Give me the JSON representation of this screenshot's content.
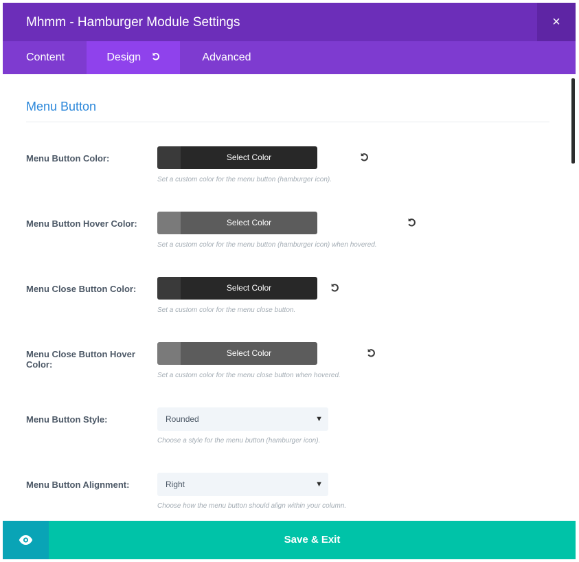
{
  "header": {
    "title": "Mhmm - Hamburger Module Settings",
    "close_glyph": "×"
  },
  "tabs": [
    {
      "label": "Content",
      "active": false
    },
    {
      "label": "Design",
      "active": true,
      "icon": "reset-icon"
    },
    {
      "label": "Advanced",
      "active": false
    }
  ],
  "section": {
    "title": "Menu Button"
  },
  "settings": {
    "menu_button_color": {
      "label": "Menu Button Color:",
      "button_label": "Select Color",
      "description": "Set a custom color for the menu button (hamburger icon).",
      "swatch_color": "#3a3a3a"
    },
    "menu_button_hover_color": {
      "label": "Menu Button Hover Color:",
      "button_label": "Select Color",
      "description": "Set a custom color for the menu button (hamburger icon) when hovered.",
      "swatch_color": "#7a7a7a"
    },
    "menu_close_button_color": {
      "label": "Menu Close Button Color:",
      "button_label": "Select Color",
      "description": "Set a custom color for the menu close button.",
      "swatch_color": "#3a3a3a"
    },
    "menu_close_button_hover_color": {
      "label": "Menu Close Button Hover Color:",
      "button_label": "Select Color",
      "description": "Set a custom color for the menu close button when hovered.",
      "swatch_color": "#7a7a7a"
    },
    "menu_button_style": {
      "label": "Menu Button Style:",
      "value": "Rounded",
      "description": "Choose a style for the menu button (hamburger icon)."
    },
    "menu_button_alignment": {
      "label": "Menu Button Alignment:",
      "value": "Right",
      "description": "Choose how the menu button should align within your column."
    }
  },
  "footer": {
    "preview_icon": "eye-icon",
    "save_label": "Save & Exit"
  },
  "colors": {
    "header_bg": "#6c2eb9",
    "tabs_bg": "#7e3bd0",
    "active_tab_bg": "#8f42ec",
    "save_bg": "#00c3a8",
    "preview_bg": "#09a4b6",
    "section_title": "#2b87da"
  }
}
